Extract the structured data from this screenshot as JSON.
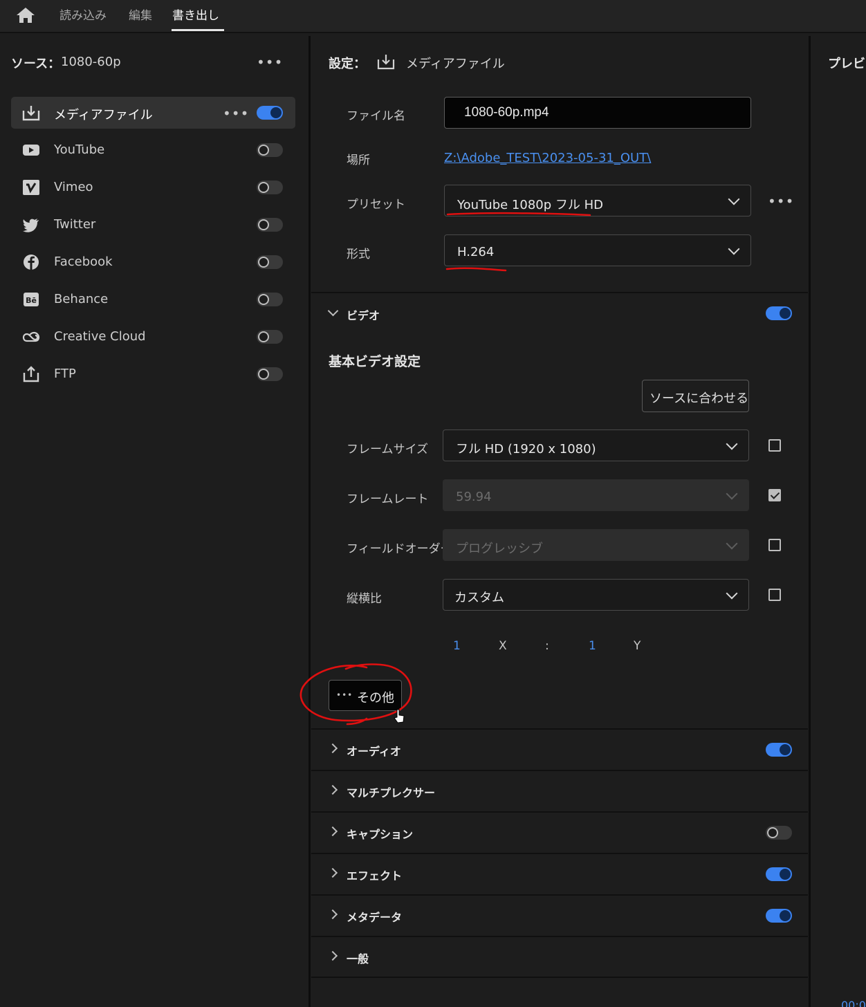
{
  "nav": {
    "home_icon": "home-icon",
    "tabs": [
      {
        "label": "読み込み",
        "active": false
      },
      {
        "label": "編集",
        "active": false
      },
      {
        "label": "書き出し",
        "active": true
      }
    ]
  },
  "source": {
    "label": "ソース：",
    "value": "1080-60p",
    "more": "•••"
  },
  "destinations": [
    {
      "label": "メディアファイル",
      "icon": "media-file-download-icon",
      "enabled": true,
      "active": true,
      "more": "•••"
    },
    {
      "label": "YouTube",
      "icon": "youtube-icon",
      "enabled": false
    },
    {
      "label": "Vimeo",
      "icon": "vimeo-icon",
      "enabled": false
    },
    {
      "label": "Twitter",
      "icon": "twitter-icon",
      "enabled": false
    },
    {
      "label": "Facebook",
      "icon": "facebook-icon",
      "enabled": false
    },
    {
      "label": "Behance",
      "icon": "behance-icon",
      "enabled": false
    },
    {
      "label": "Creative Cloud",
      "icon": "creative-cloud-icon",
      "enabled": false
    },
    {
      "label": "FTP",
      "icon": "ftp-upload-icon",
      "enabled": false
    }
  ],
  "settings": {
    "title": "設定：",
    "destination_label": "メディアファイル",
    "filename_label": "ファイル名",
    "filename_value": "1080-60p.mp4",
    "location_label": "場所",
    "location_value": "Z:\\Adobe_TEST\\2023-05-31_OUT\\",
    "preset_label": "プリセット",
    "preset_value": "YouTube 1080p フル HD",
    "preset_more": "•••",
    "format_label": "形式",
    "format_value": "H.264"
  },
  "video": {
    "title": "ビデオ",
    "enabled": true,
    "basic_title": "基本ビデオ設定",
    "match_source_button": "ソースに合わせる",
    "frame_size_label": "フレームサイズ",
    "frame_size_value": "フル HD (1920 x 1080)",
    "frame_size_checked": false,
    "frame_rate_label": "フレームレート",
    "frame_rate_value": "59.94",
    "frame_rate_checked": true,
    "field_order_label": "フィールドオーダー",
    "field_order_value": "プログレッシブ",
    "field_order_checked": false,
    "aspect_label": "縦横比",
    "aspect_value": "カスタム",
    "aspect_checked": false,
    "aspect_x": "1",
    "aspect_x_label": "X",
    "aspect_sep": ":",
    "aspect_y": "1",
    "aspect_y_label": "Y",
    "more_button": "その他",
    "more_dots": "•••"
  },
  "sections": [
    {
      "title": "オーディオ",
      "toggle": true,
      "enabled": true
    },
    {
      "title": "マルチプレクサー",
      "toggle": false
    },
    {
      "title": "キャプション",
      "toggle": true,
      "enabled": false
    },
    {
      "title": "エフェクト",
      "toggle": true,
      "enabled": true
    },
    {
      "title": "メタデータ",
      "toggle": true,
      "enabled": true
    },
    {
      "title": "一般",
      "toggle": false
    }
  ],
  "preview": {
    "title": "プレビュー",
    "timecode": "00:0"
  },
  "colors": {
    "accent": "#3b82f0",
    "link": "#4a90f0",
    "annotation": "#e01010"
  }
}
